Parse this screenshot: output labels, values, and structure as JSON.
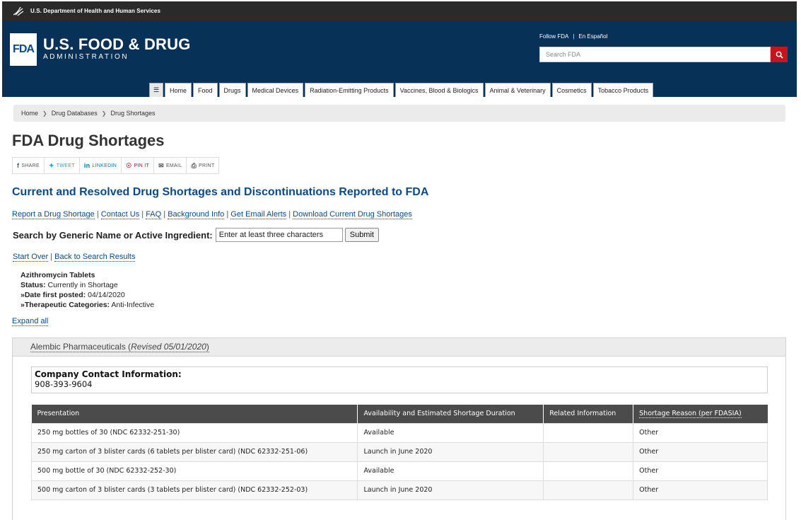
{
  "hhs": {
    "label": "U.S. Department of Health and Human Services",
    "icon": "hhs-eagle-icon"
  },
  "header": {
    "logo_text": "FDA",
    "title": "U.S. FOOD & DRUG",
    "subtitle": "ADMINISTRATION",
    "follow_label": "Follow FDA",
    "espanol_label": "En Español",
    "search_placeholder": "Search FDA",
    "search_icon": "search-icon",
    "colors": {
      "header_bg": "#073157",
      "search_button": "#c4161c"
    }
  },
  "nav": {
    "menu_icon": "hamburger-icon",
    "items": [
      "Home",
      "Food",
      "Drugs",
      "Medical Devices",
      "Radiation-Emitting Products",
      "Vaccines, Blood & Biologics",
      "Animal & Veterinary",
      "Cosmetics",
      "Tobacco Products"
    ]
  },
  "breadcrumb": [
    "Home",
    "Drug Databases",
    "Drug Shortages"
  ],
  "page_title": "FDA Drug Shortages",
  "share": [
    {
      "label": "SHARE",
      "icon": "facebook-icon"
    },
    {
      "label": "TWEET",
      "icon": "twitter-icon"
    },
    {
      "label": "LINKEDIN",
      "icon": "linkedin-icon"
    },
    {
      "label": "PIN IT",
      "icon": "pinterest-icon"
    },
    {
      "label": "EMAIL",
      "icon": "email-icon"
    },
    {
      "label": "PRINT",
      "icon": "print-icon"
    }
  ],
  "sub_title": "Current and Resolved Drug Shortages and Discontinuations Reported to FDA",
  "links": [
    "Report a Drug Shortage",
    "Contact Us",
    "FAQ",
    "Background Info",
    "Get Email Alerts",
    "Download Current Drug Shortages"
  ],
  "search": {
    "label": "Search by Generic Name or Active Ingredient:",
    "input_value": "Enter at least three characters",
    "submit_label": "Submit"
  },
  "nav_links": {
    "start_over": "Start Over",
    "back": "Back to Search Results"
  },
  "drug": {
    "name": "Azithromycin Tablets",
    "status_label": "Status:",
    "status_value": "Currently in Shortage",
    "date_label": "»Date first posted:",
    "date_value": "04/14/2020",
    "categories_label": "»Therapeutic Categories:",
    "categories_value": "Anti-Infective"
  },
  "expand_all": "Expand all",
  "company": {
    "name": "Alembic Pharmaceuticals",
    "revised": "Revised 05/01/2020",
    "contact_title": "Company Contact Information:",
    "phone": "908-393-9604"
  },
  "table": {
    "headers": [
      "Presentation",
      "Availability and Estimated Shortage Duration",
      "Related Information",
      "Shortage Reason (per FDASIA)"
    ],
    "rows": [
      [
        "250 mg bottles of 30 (NDC 62332-251-30)",
        "Available",
        "",
        "Other"
      ],
      [
        "250 mg carton of 3 blister cards (6 tablets per blister card) (NDC 62332-251-06)",
        "Launch in June 2020",
        "",
        "Other"
      ],
      [
        "500 mg bottle of 30 (NDC 62332-252-30)",
        "Available",
        "",
        "Other"
      ],
      [
        "500 mg carton of 3 blister cards (3 tablets per blister card) (NDC 62332-252-03)",
        "Launch in June 2020",
        "",
        "Other"
      ]
    ]
  }
}
